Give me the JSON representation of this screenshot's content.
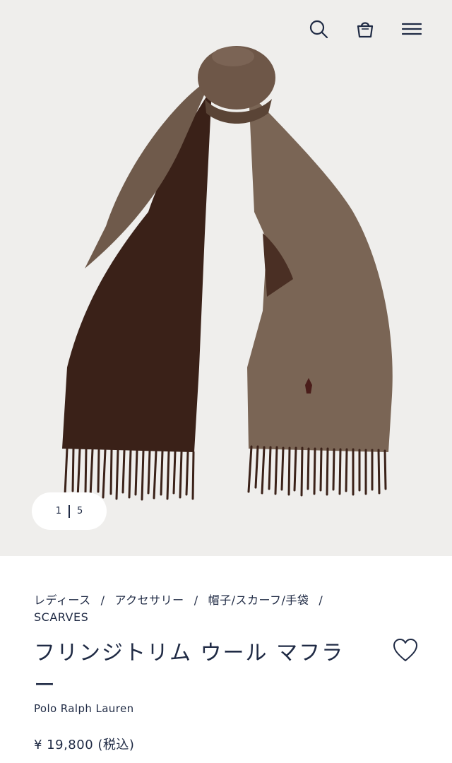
{
  "pager": {
    "current": "1",
    "total": "5"
  },
  "breadcrumb": {
    "items": [
      "レディース",
      "アクセサリー",
      "帽子/スカーフ/手袋",
      "SCARVES"
    ],
    "separator": "/"
  },
  "product": {
    "title": "フリンジトリム ウール マフラー",
    "brand": "Polo Ralph Lauren",
    "price": "¥ 19,800 (税込)"
  },
  "icons": {
    "search": "search-icon",
    "cart": "shopping-bag-icon",
    "menu": "hamburger-menu-icon",
    "favorite": "heart-icon"
  },
  "colors": {
    "text": "#1f2a44",
    "hero_bg": "#efeeec",
    "scarf_light": "#7a6555",
    "scarf_dark": "#3a2118"
  }
}
